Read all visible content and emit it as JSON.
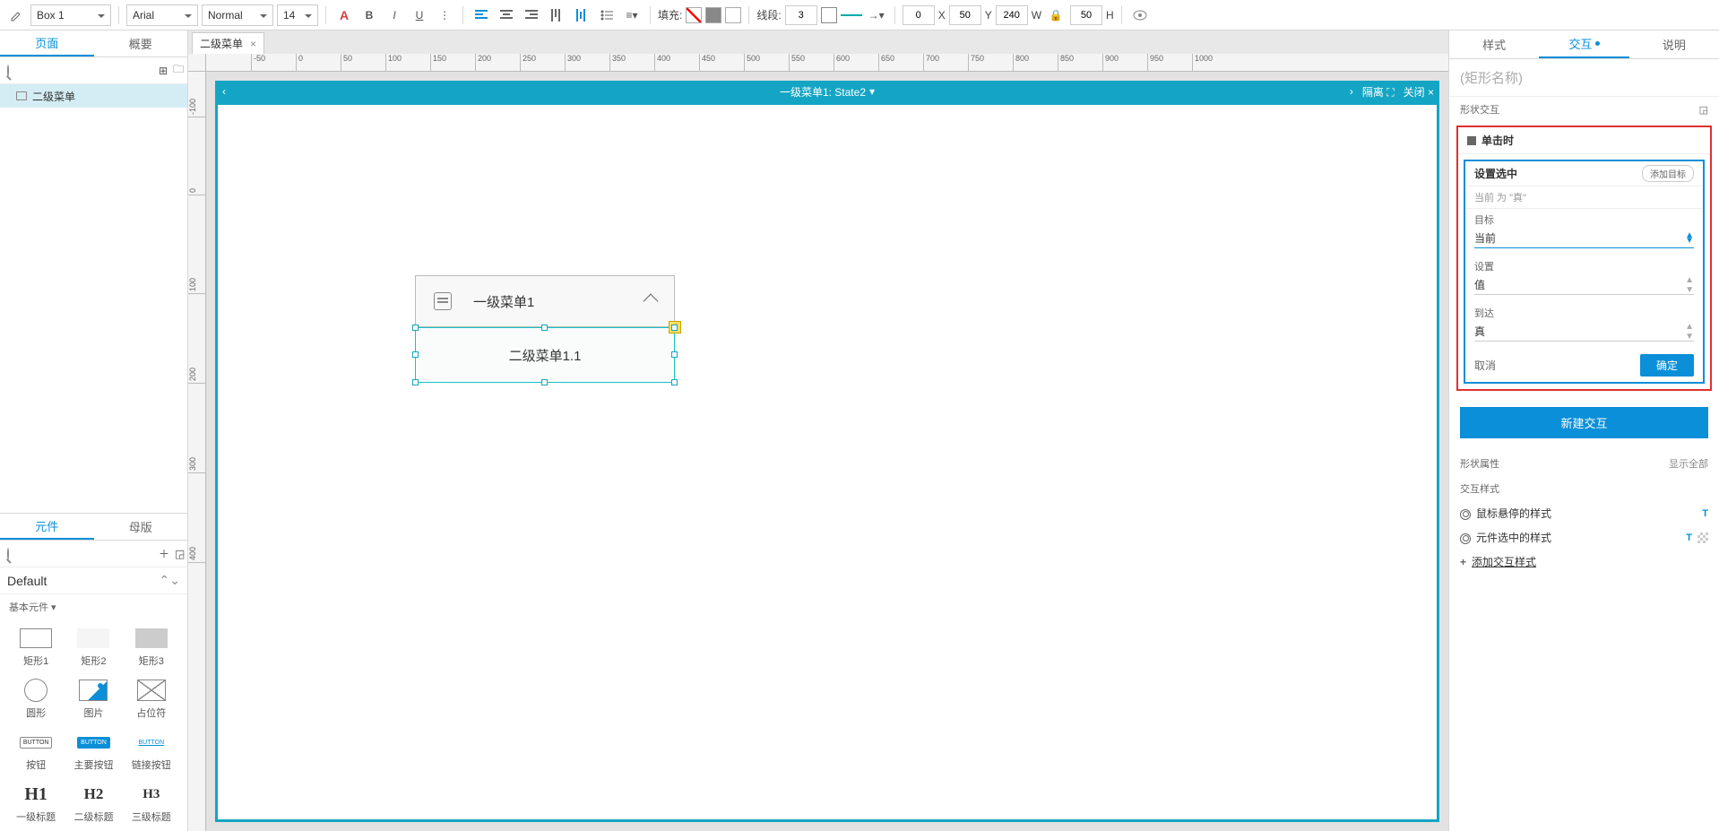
{
  "toolbar": {
    "shape_name": "Box 1",
    "font": "Arial",
    "font_style": "Normal",
    "font_size": "14",
    "fill_label": "填充:",
    "stroke_label": "线段:",
    "stroke_width": "3",
    "x_label": "X",
    "x_val": "0",
    "y_label": "Y",
    "y_val": "50",
    "w_label": "W",
    "w_val": "240",
    "h_label": "H",
    "h_val": "50"
  },
  "left": {
    "tab_pages": "页面",
    "tab_outline": "概要",
    "tree_item": "二级菜单",
    "tab_widgets": "元件",
    "tab_masters": "母版",
    "lib_name": "Default",
    "lib_group": "基本元件 ▾",
    "widgets": [
      "矩形1",
      "矩形2",
      "矩形3",
      "圆形",
      "图片",
      "占位符",
      "按钮",
      "主要按钮",
      "链接按钮",
      "一级标题",
      "二级标题",
      "三级标题"
    ],
    "h_labels": [
      "H1",
      "H2",
      "H3"
    ]
  },
  "canvas": {
    "doc_tab": "二级菜单",
    "dp_title": "一级菜单1: State2",
    "isolate": "隔离",
    "close": "关闭",
    "menu1_text": "一级菜单1",
    "menu2_text": "二级菜单1.1",
    "h_ticks": [
      "-50",
      "0",
      "50",
      "100",
      "150",
      "200",
      "250",
      "300",
      "350",
      "400",
      "450",
      "500",
      "550",
      "600",
      "650",
      "700",
      "750",
      "800",
      "850",
      "900",
      "950",
      "1000"
    ],
    "v_ticks": [
      "-100",
      "0",
      "100",
      "200",
      "300",
      "400"
    ]
  },
  "right": {
    "tab_style": "样式",
    "tab_interact": "交互",
    "tab_notes": "说明",
    "shape_name_placeholder": "(矩形名称)",
    "section_shape_ix": "形状交互",
    "event_label": "单击时",
    "action_label": "设置选中",
    "add_target": "添加目标",
    "condition_text": "当前 为 \"真\"",
    "target_label": "目标",
    "target_value": "当前",
    "set_label": "设置",
    "set_value": "值",
    "to_label": "到达",
    "to_value": "真",
    "cancel": "取消",
    "ok": "确定",
    "new_interaction": "新建交互",
    "section_props": "形状属性",
    "show_all": "显示全部",
    "section_ix_style": "交互样式",
    "hover_style": "鼠标悬停的样式",
    "selected_style": "元件选中的样式",
    "add_ix_style": "添加交互样式"
  }
}
